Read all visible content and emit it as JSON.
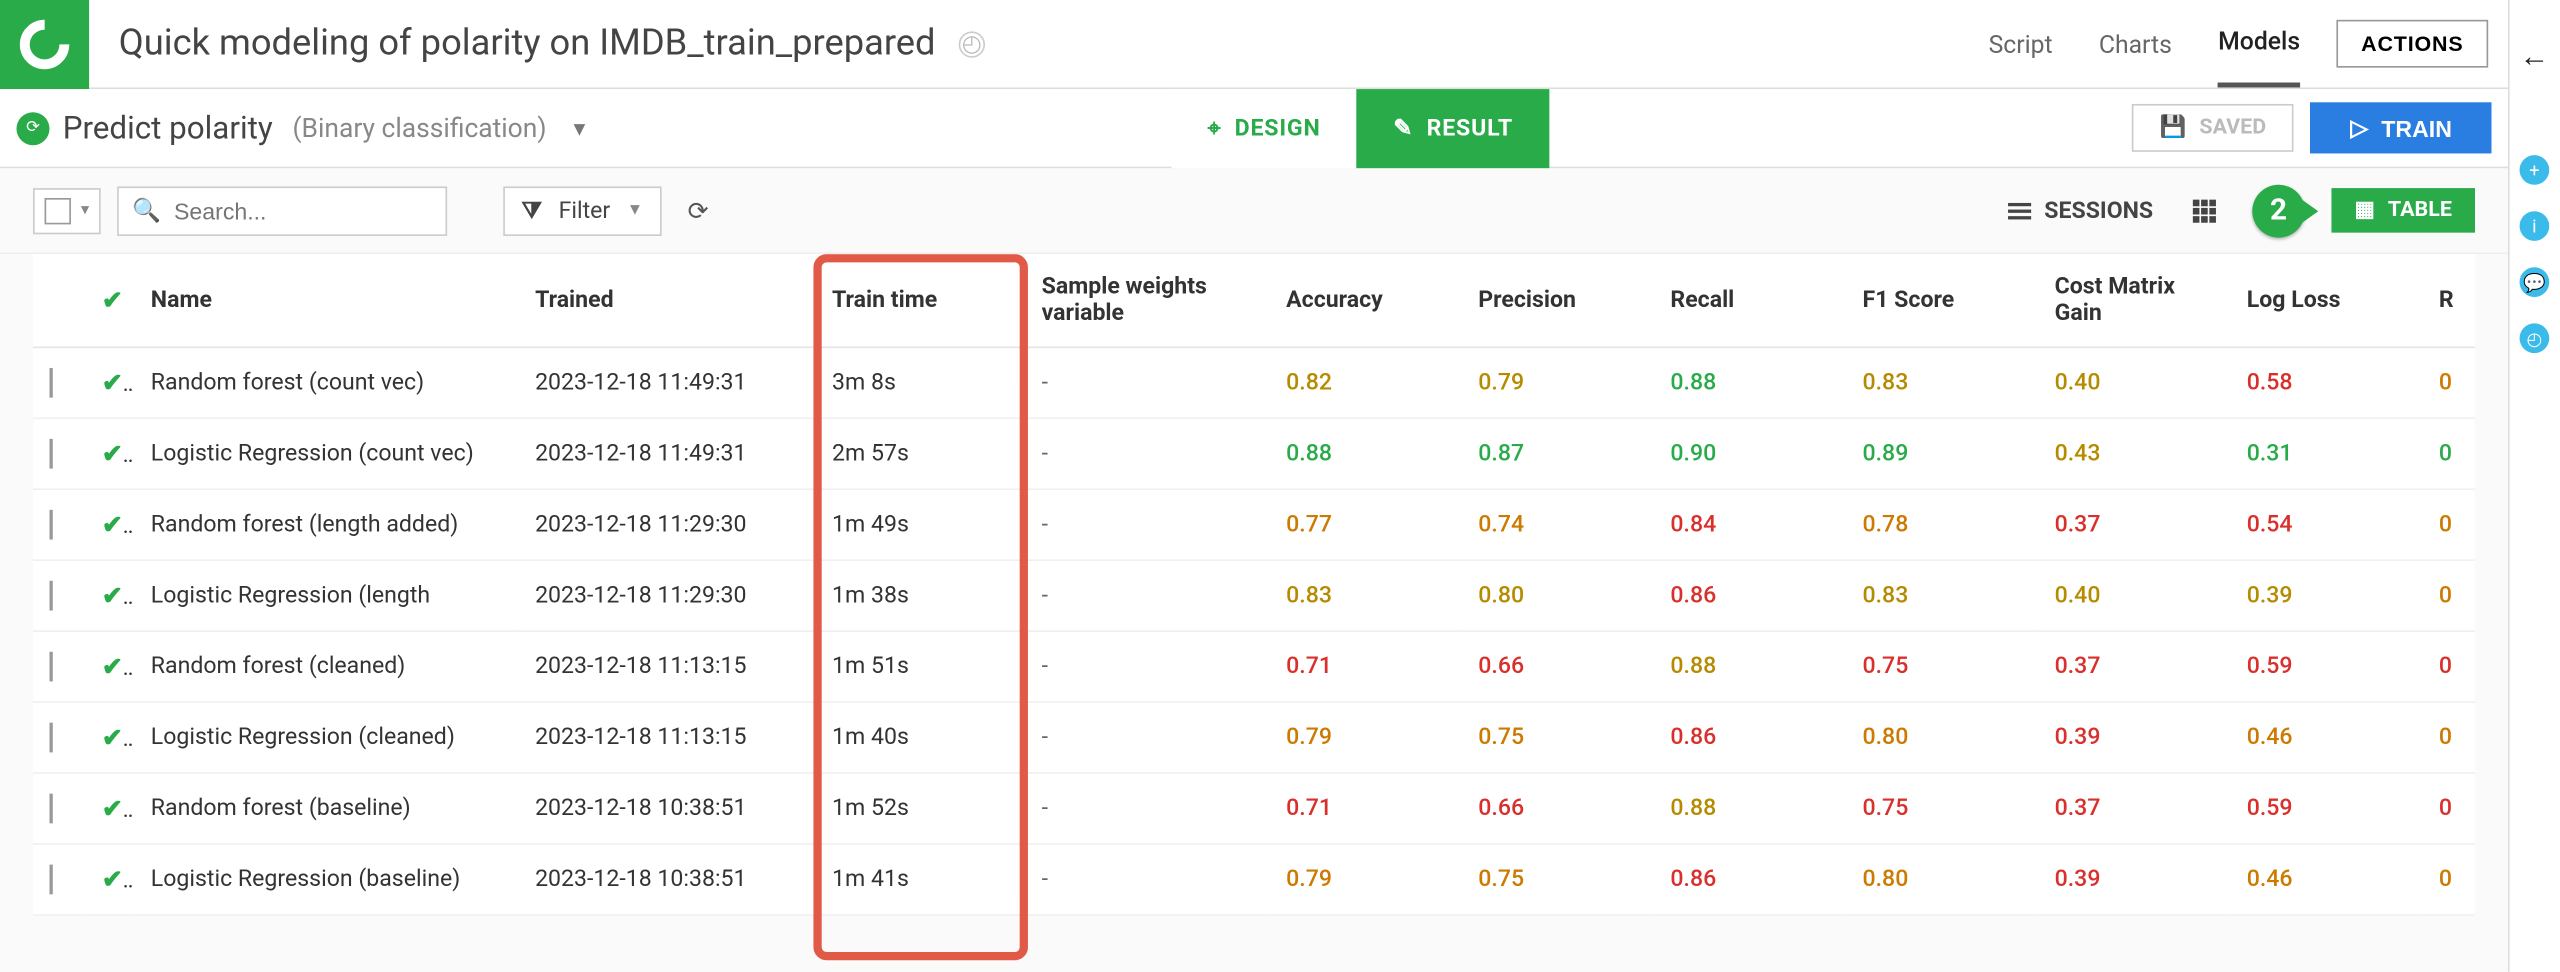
{
  "header": {
    "title": "Quick modeling of polarity on IMDB_train_prepared",
    "tabs": [
      {
        "label": "Script",
        "active": false
      },
      {
        "label": "Charts",
        "active": false
      },
      {
        "label": "Models",
        "active": true
      }
    ],
    "actions_label": "ACTIONS"
  },
  "subheader": {
    "title": "Predict polarity",
    "subtitle": "(Binary classification)",
    "design_label": "DESIGN",
    "result_label": "RESULT",
    "saved_label": "SAVED",
    "train_label": "TRAIN"
  },
  "toolbar": {
    "search_placeholder": "Search...",
    "filter_label": "Filter",
    "sessions_label": "SESSIONS",
    "table_label": "TABLE",
    "callout_number": "2"
  },
  "table": {
    "columns": [
      "",
      "",
      "Name",
      "Trained",
      "Train time",
      "Sample weights variable",
      "Accuracy",
      "Precision",
      "Recall",
      "F1 Score",
      "Cost Matrix Gain",
      "Log Loss",
      "R"
    ],
    "rows": [
      {
        "name": "Random forest (count vec)",
        "trained": "2023-12-18 11:49:31",
        "train_time": "3m 8s",
        "sample": "-",
        "accuracy": {
          "v": "0.82",
          "c": "c-warn"
        },
        "precision": {
          "v": "0.79",
          "c": "c-warn"
        },
        "recall": {
          "v": "0.88",
          "c": "c-good"
        },
        "f1": {
          "v": "0.83",
          "c": "c-warn"
        },
        "cmg": {
          "v": "0.40",
          "c": "c-warn"
        },
        "logloss": {
          "v": "0.58",
          "c": "c-bad"
        },
        "r": {
          "v": "0",
          "c": "c-mid"
        }
      },
      {
        "name": "Logistic Regression (count vec)",
        "trained": "2023-12-18 11:49:31",
        "train_time": "2m 57s",
        "sample": "-",
        "accuracy": {
          "v": "0.88",
          "c": "c-good"
        },
        "precision": {
          "v": "0.87",
          "c": "c-good"
        },
        "recall": {
          "v": "0.90",
          "c": "c-good"
        },
        "f1": {
          "v": "0.89",
          "c": "c-good"
        },
        "cmg": {
          "v": "0.43",
          "c": "c-warn"
        },
        "logloss": {
          "v": "0.31",
          "c": "c-good"
        },
        "r": {
          "v": "0",
          "c": "c-good"
        }
      },
      {
        "name": "Random forest (length added)",
        "trained": "2023-12-18 11:29:30",
        "train_time": "1m 49s",
        "sample": "-",
        "accuracy": {
          "v": "0.77",
          "c": "c-mid"
        },
        "precision": {
          "v": "0.74",
          "c": "c-mid"
        },
        "recall": {
          "v": "0.84",
          "c": "c-bad"
        },
        "f1": {
          "v": "0.78",
          "c": "c-mid"
        },
        "cmg": {
          "v": "0.37",
          "c": "c-bad"
        },
        "logloss": {
          "v": "0.54",
          "c": "c-bad"
        },
        "r": {
          "v": "0",
          "c": "c-mid"
        }
      },
      {
        "name": "Logistic Regression (length",
        "trained": "2023-12-18 11:29:30",
        "train_time": "1m 38s",
        "sample": "-",
        "accuracy": {
          "v": "0.83",
          "c": "c-warn"
        },
        "precision": {
          "v": "0.80",
          "c": "c-warn"
        },
        "recall": {
          "v": "0.86",
          "c": "c-bad"
        },
        "f1": {
          "v": "0.83",
          "c": "c-warn"
        },
        "cmg": {
          "v": "0.40",
          "c": "c-warn"
        },
        "logloss": {
          "v": "0.39",
          "c": "c-warn"
        },
        "r": {
          "v": "0",
          "c": "c-mid"
        }
      },
      {
        "name": "Random forest (cleaned)",
        "trained": "2023-12-18 11:13:15",
        "train_time": "1m 51s",
        "sample": "-",
        "accuracy": {
          "v": "0.71",
          "c": "c-bad"
        },
        "precision": {
          "v": "0.66",
          "c": "c-bad"
        },
        "recall": {
          "v": "0.88",
          "c": "c-warn"
        },
        "f1": {
          "v": "0.75",
          "c": "c-bad"
        },
        "cmg": {
          "v": "0.37",
          "c": "c-bad"
        },
        "logloss": {
          "v": "0.59",
          "c": "c-bad"
        },
        "r": {
          "v": "0",
          "c": "c-bad"
        }
      },
      {
        "name": "Logistic Regression (cleaned)",
        "trained": "2023-12-18 11:13:15",
        "train_time": "1m 40s",
        "sample": "-",
        "accuracy": {
          "v": "0.79",
          "c": "c-mid"
        },
        "precision": {
          "v": "0.75",
          "c": "c-mid"
        },
        "recall": {
          "v": "0.86",
          "c": "c-bad"
        },
        "f1": {
          "v": "0.80",
          "c": "c-mid"
        },
        "cmg": {
          "v": "0.39",
          "c": "c-bad"
        },
        "logloss": {
          "v": "0.46",
          "c": "c-mid"
        },
        "r": {
          "v": "0",
          "c": "c-mid"
        }
      },
      {
        "name": "Random forest (baseline)",
        "trained": "2023-12-18 10:38:51",
        "train_time": "1m 52s",
        "sample": "-",
        "accuracy": {
          "v": "0.71",
          "c": "c-bad"
        },
        "precision": {
          "v": "0.66",
          "c": "c-bad"
        },
        "recall": {
          "v": "0.88",
          "c": "c-warn"
        },
        "f1": {
          "v": "0.75",
          "c": "c-bad"
        },
        "cmg": {
          "v": "0.37",
          "c": "c-bad"
        },
        "logloss": {
          "v": "0.59",
          "c": "c-bad"
        },
        "r": {
          "v": "0",
          "c": "c-bad"
        }
      },
      {
        "name": "Logistic Regression (baseline)",
        "trained": "2023-12-18 10:38:51",
        "train_time": "1m 41s",
        "sample": "-",
        "accuracy": {
          "v": "0.79",
          "c": "c-mid"
        },
        "precision": {
          "v": "0.75",
          "c": "c-mid"
        },
        "recall": {
          "v": "0.86",
          "c": "c-bad"
        },
        "f1": {
          "v": "0.80",
          "c": "c-mid"
        },
        "cmg": {
          "v": "0.39",
          "c": "c-bad"
        },
        "logloss": {
          "v": "0.46",
          "c": "c-mid"
        },
        "r": {
          "v": "0",
          "c": "c-mid"
        }
      }
    ]
  }
}
